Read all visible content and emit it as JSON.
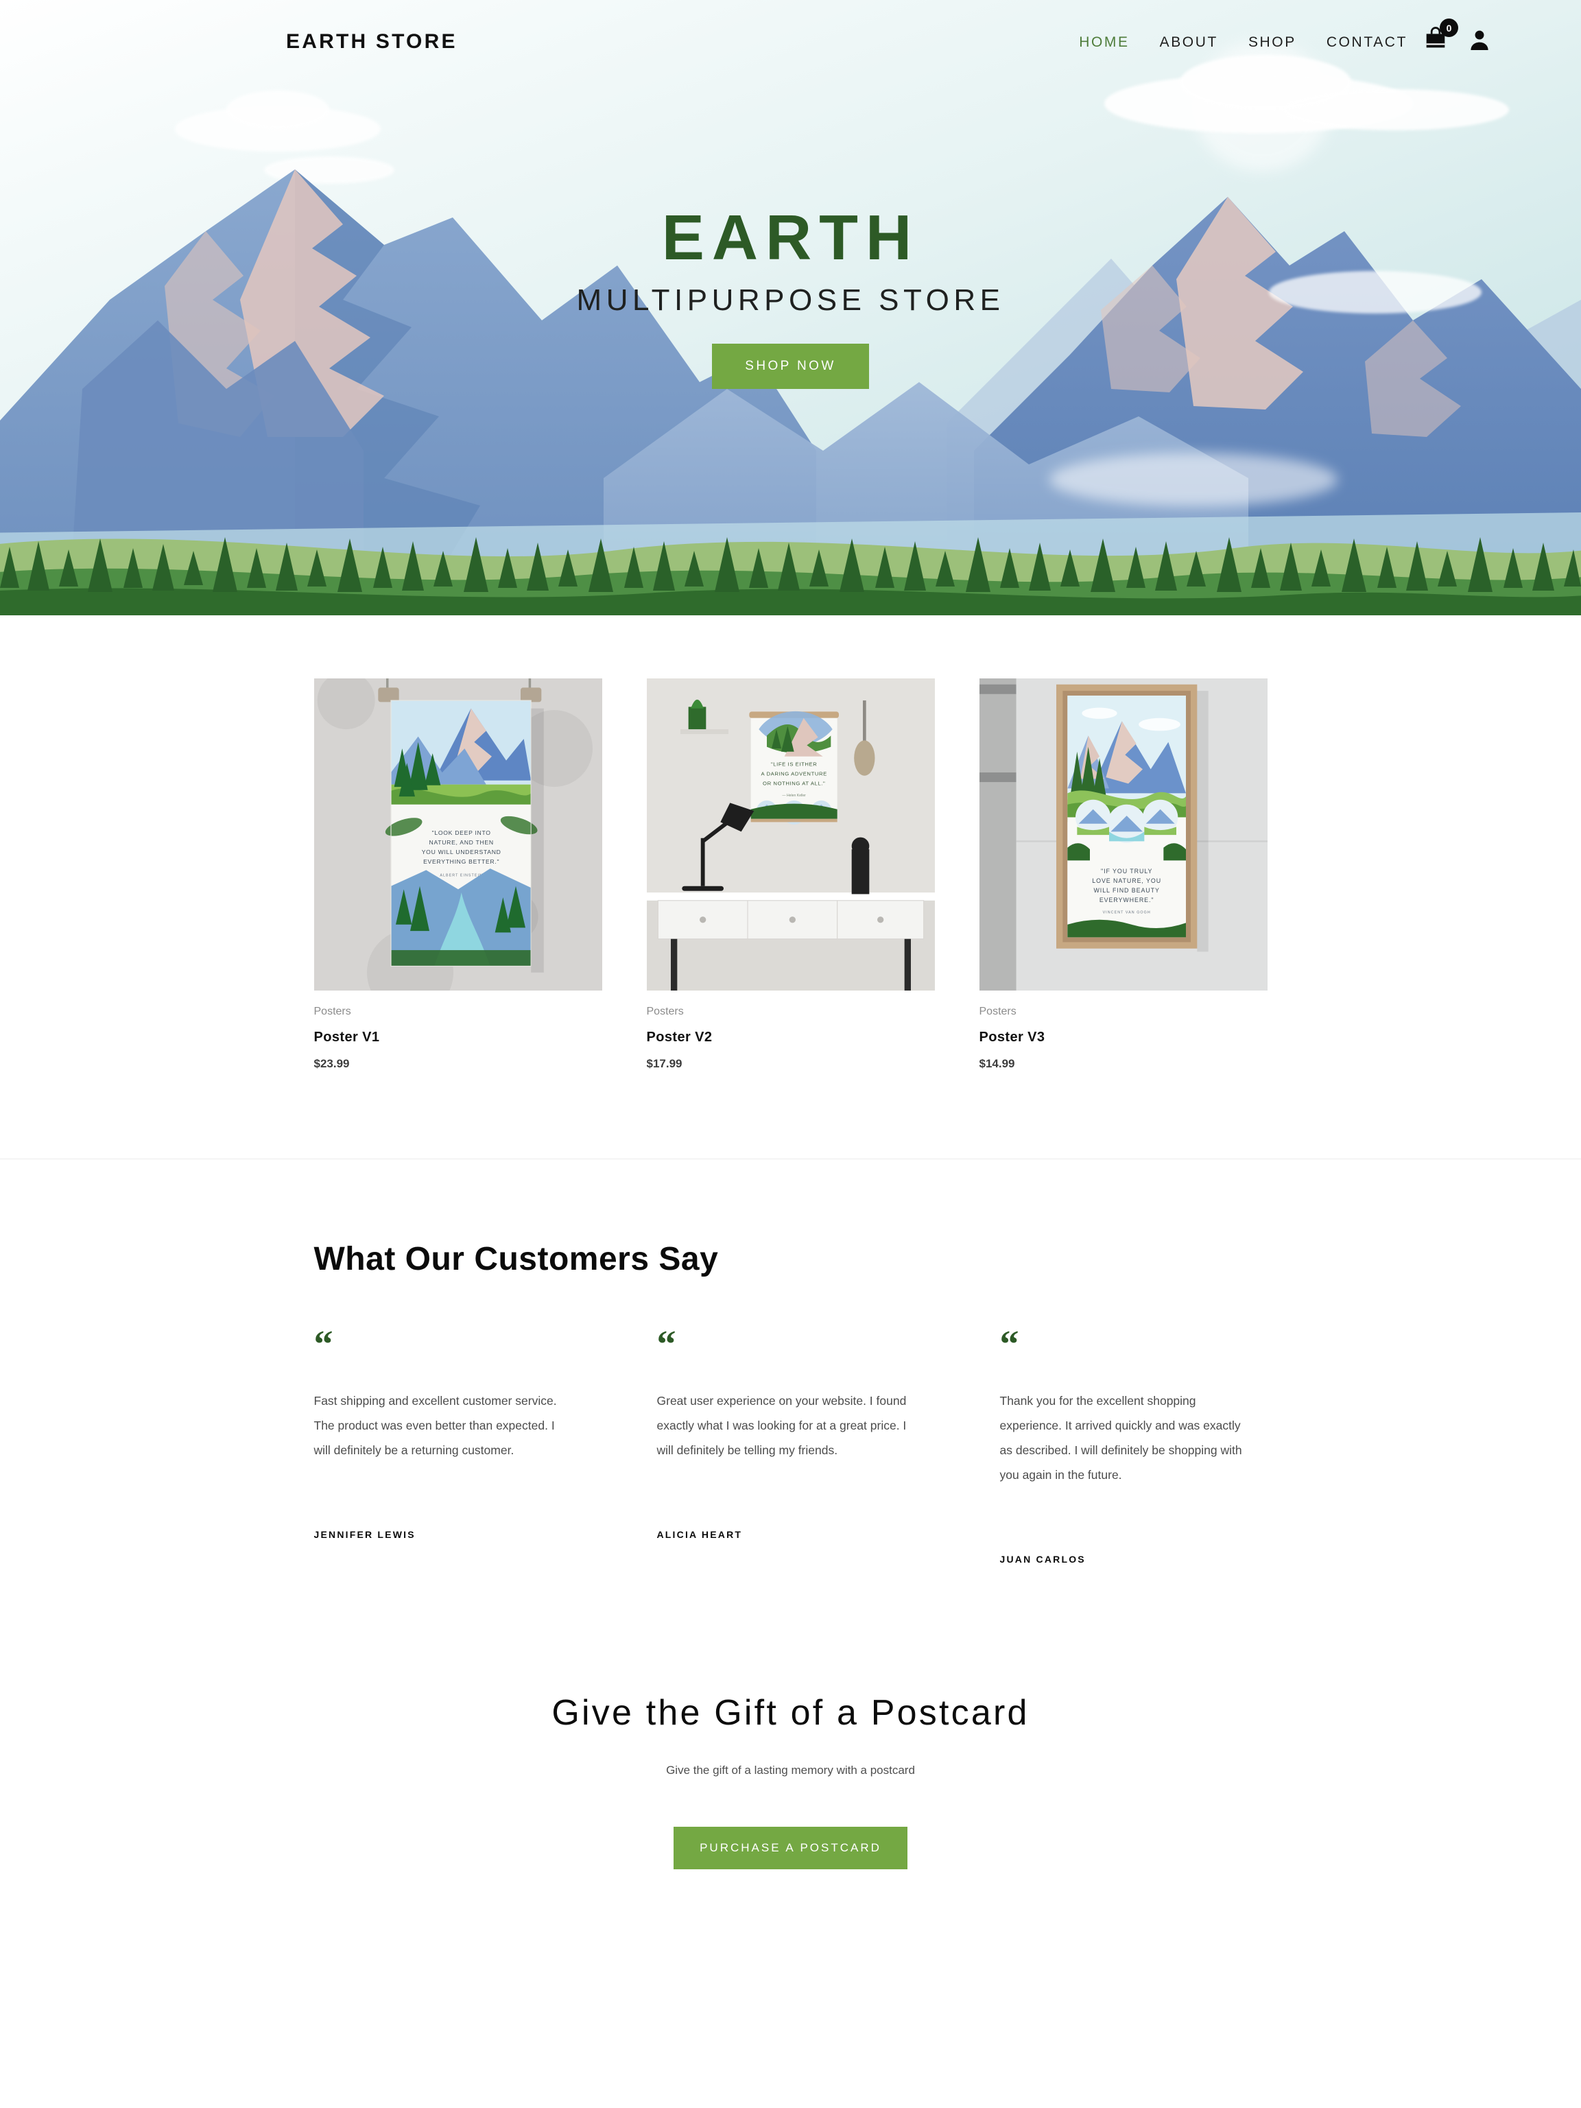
{
  "header": {
    "logo": "EARTH STORE",
    "nav": [
      {
        "label": "HOME",
        "active": true
      },
      {
        "label": "ABOUT",
        "active": false
      },
      {
        "label": "SHOP",
        "active": false
      },
      {
        "label": "CONTACT",
        "active": false
      }
    ],
    "cart_icon": "shopping-bag-icon",
    "cart_count": "0",
    "account_icon": "user-account-icon"
  },
  "hero": {
    "title": "EARTH",
    "subtitle": "MULTIPURPOSE STORE",
    "cta_label": "SHOP NOW",
    "scene": "illustrated mountain range with pine forest and clouds"
  },
  "products": [
    {
      "category": "Posters",
      "name": "Poster V1",
      "price": "$23.99",
      "poster_quote": "\"LOOK DEEP INTO NATURE, AND THEN YOU WILL UNDERSTAND EVERYTHING BETTER.\"",
      "poster_author": "ALBERT EINSTEIN",
      "scene": "poster clipped to concrete wall"
    },
    {
      "category": "Posters",
      "name": "Poster V2",
      "price": "$17.99",
      "poster_quote": "\"LIFE IS EITHER A DARING ADVENTURE OR NOTHING AT ALL.\"",
      "poster_author": "— Helen Keller",
      "scene": "wall hanging above a white desk with lamp and plant"
    },
    {
      "category": "Posters",
      "name": "Poster V3",
      "price": "$14.99",
      "poster_quote": "\"IF YOU TRULY LOVE NATURE, YOU WILL FIND BEAUTY EVERYWHERE.\"",
      "poster_author": "VINCENT VAN GOGH",
      "scene": "wood framed poster on grey wall"
    }
  ],
  "testimonials": {
    "heading": "What Our Customers Say",
    "items": [
      {
        "quote_mark": "“",
        "text": "Fast shipping and excellent customer service. The product was even better than expected. I will definitely be a returning customer.",
        "author": "JENNIFER LEWIS"
      },
      {
        "quote_mark": "“",
        "text": "Great user experience on your website. I found exactly what I was looking for at a great price. I will definitely be telling my friends.",
        "author": "ALICIA HEART"
      },
      {
        "quote_mark": "“",
        "text": "Thank you for the excellent shopping experience. It arrived quickly and was exactly as described. I will definitely be shopping with you again in the future.",
        "author": "JUAN CARLOS"
      }
    ]
  },
  "postcard_cta": {
    "heading": "Give the Gift of a Postcard",
    "subheading": "Give the gift of a lasting memory with a postcard",
    "button_label": "PURCHASE A POSTCARD"
  },
  "colors": {
    "brand_green_dark": "#2d5a26",
    "brand_green_button": "#74a843",
    "nav_active": "#4e7c3a",
    "text_dark": "#111111",
    "text_muted": "#8b8b8b",
    "body_text": "#4c4c4c"
  }
}
